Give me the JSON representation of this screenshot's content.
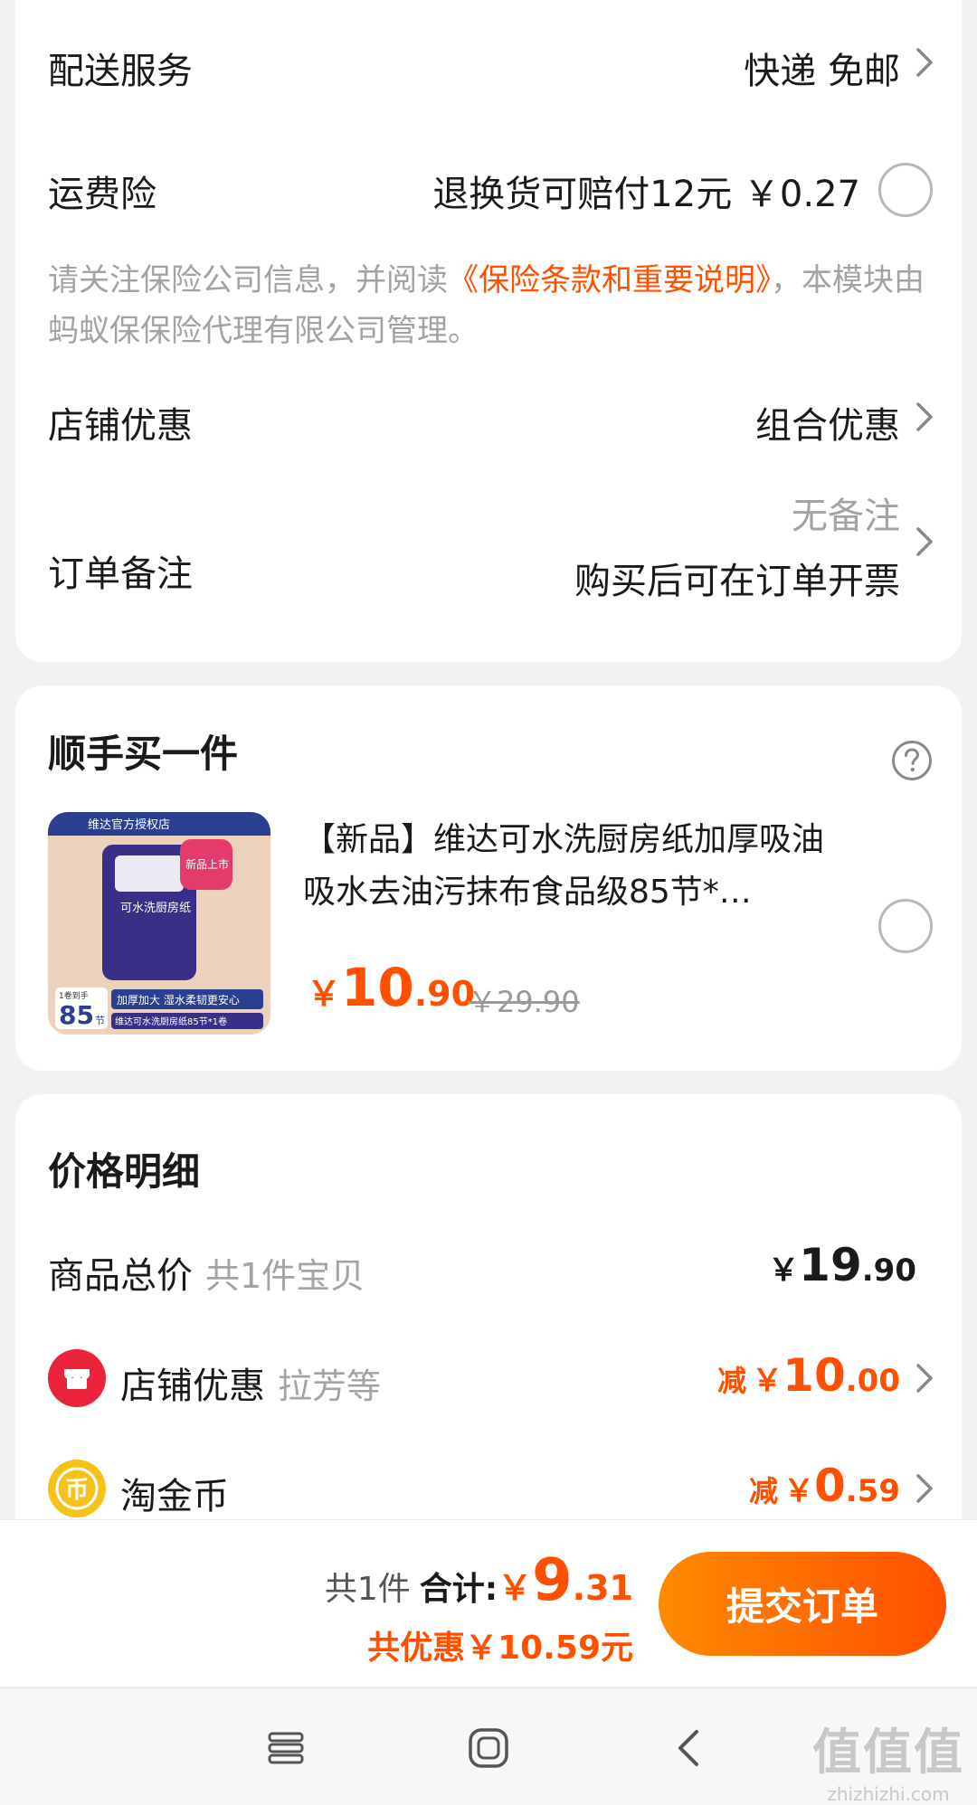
{
  "delivery": {
    "label": "配送服务",
    "value": "快递 免邮"
  },
  "shipping_insurance": {
    "label": "运费险",
    "value": "退换货可赔付12元 ￥0.27"
  },
  "insurance_note": {
    "prefix": "请关注保险公司信息，并阅读",
    "link": "《保险条款和重要说明》",
    "suffix": "，本模块由蚂蚁保保险代理有限公司管理。"
  },
  "store_discount": {
    "label": "店铺优惠",
    "value": "组合优惠"
  },
  "order_note": {
    "label": "订单备注",
    "value": "无备注",
    "sub": "购买后可在订单开票"
  },
  "addon": {
    "title": "顺手买一件",
    "product": {
      "title": "【新品】维达可水洗厨房纸加厚吸油吸水去油污抹布食品级85节*…",
      "price_currency": "￥",
      "price_int": "10",
      "price_dec": ".90",
      "original_price": "￥29.90",
      "image_texts": {
        "shop": "维达官方授权店",
        "tag": "新品上市",
        "pack": "可水洗厨房纸",
        "count_label": "1卷到手",
        "count": "85",
        "count_unit": "节",
        "banner": "加厚加大 湿水柔韧更安心",
        "bottom": "维达可水洗厨房纸85节*1卷"
      }
    }
  },
  "price_detail": {
    "title": "价格明细",
    "goods_total": {
      "label": "商品总价",
      "sub": "共1件宝贝",
      "cur": "￥",
      "int": "19",
      "dec": ".90"
    },
    "store_discount": {
      "label": "店铺优惠",
      "sub": "拉芳等",
      "prefix": "减",
      "cur": "￥",
      "int": "10",
      "dec": ".00"
    },
    "gold_coin": {
      "label": "淘金币",
      "prefix": "减",
      "cur": "￥",
      "int": "0",
      "dec": ".59"
    }
  },
  "footer": {
    "count": "共1件",
    "total_label": "合计:",
    "total_cur": "￥",
    "total_int": "9",
    "total_dec": ".31",
    "saved": "共优惠￥10.59元",
    "submit": "提交订单"
  },
  "watermark": {
    "main": "值值值",
    "sub": "zhizhizhi.com"
  },
  "icons": {
    "chevron": "chevron-right-icon",
    "help": "question-circle-icon",
    "store": "store-icon",
    "coin": "coin-icon",
    "nav": [
      "menu-icon",
      "home-icon",
      "back-icon"
    ]
  },
  "colors": {
    "accent": "#ff5000",
    "accent_start": "#ff8a00",
    "muted": "#a3a3a3",
    "background": "#f2f2f2"
  }
}
